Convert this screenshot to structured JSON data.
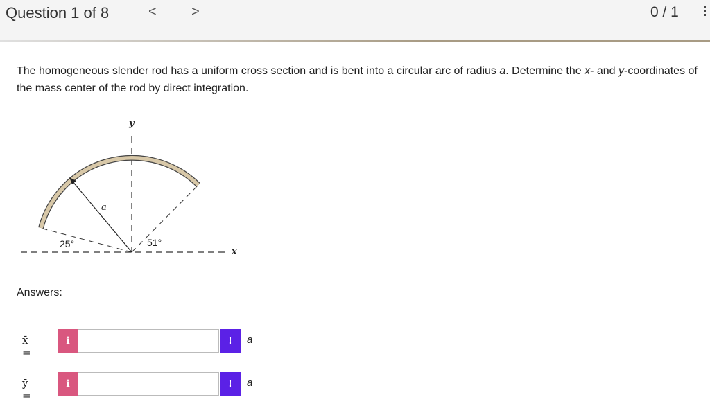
{
  "header": {
    "question_label": "Question 1 of 8",
    "prev_glyph": "<",
    "next_glyph": ">",
    "score": "0 / 1",
    "menu_icon": "vertical-dots-icon"
  },
  "question": {
    "text_part1": "The homogeneous slender rod has a uniform cross section and is bent into a circular arc of radius ",
    "radius_symbol": "a",
    "text_part2": ". Determine the ",
    "x_symbol": "x",
    "text_part3": "- and ",
    "y_symbol": "y",
    "text_part4": "-coordinates of the mass center of the rod by direct integration."
  },
  "diagram": {
    "y_axis_label": "y",
    "x_axis_label": "x",
    "radius_label": "a",
    "left_angle": "25°",
    "right_angle": "51°",
    "rod_color": "#d8c8a8"
  },
  "answers": {
    "label": "Answers:",
    "rows": [
      {
        "symbol": "x̄ =",
        "info": "i",
        "warn": "!",
        "unit": "a",
        "value": ""
      },
      {
        "symbol": "ȳ =",
        "info": "i",
        "warn": "!",
        "unit": "a",
        "value": ""
      }
    ]
  },
  "colors": {
    "info_button": "#d9577f",
    "warn_button": "#5b21e6"
  }
}
